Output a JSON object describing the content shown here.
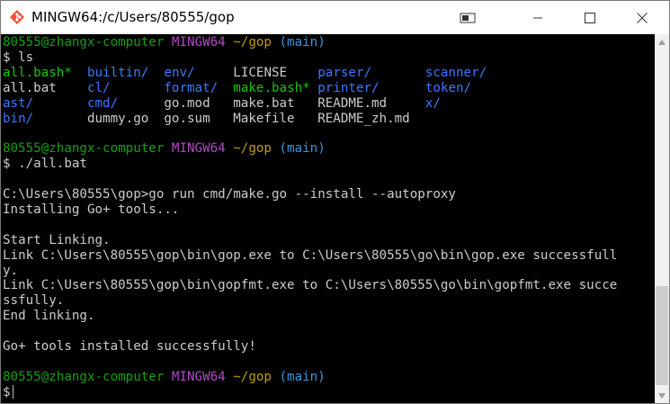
{
  "window": {
    "title": "MINGW64:/c/Users/80555/gop"
  },
  "colors": {
    "green": "#13a10e",
    "purple": "#b148c6",
    "yellow": "#c19c00",
    "cyan": "#3a96dd",
    "white": "#cccccc",
    "blue": "#3b78ff",
    "bright_green": "#16c60c",
    "bright_purple": "#b4009e"
  },
  "terminal": {
    "lines": [
      [
        {
          "t": "80555@zhangx-computer ",
          "c": "#13a10e"
        },
        {
          "t": "MINGW64 ",
          "c": "#b148c6"
        },
        {
          "t": "~/gop ",
          "c": "#c19c00"
        },
        {
          "t": "(main)",
          "c": "#3a96dd"
        }
      ],
      [
        {
          "t": "$ ls",
          "c": "#cccccc"
        }
      ],
      [
        {
          "t": "all.bash*",
          "c": "#16c60c"
        },
        {
          "t": "  ",
          "c": "#cccccc"
        },
        {
          "t": "builtin/",
          "c": "#3b78ff"
        },
        {
          "t": "  ",
          "c": "#cccccc"
        },
        {
          "t": "env/",
          "c": "#3b78ff"
        },
        {
          "t": "     LICENSE    ",
          "c": "#cccccc"
        },
        {
          "t": "parser/",
          "c": "#3b78ff"
        },
        {
          "t": "       ",
          "c": "#cccccc"
        },
        {
          "t": "scanner/",
          "c": "#3b78ff"
        }
      ],
      [
        {
          "t": "all.bat    ",
          "c": "#cccccc"
        },
        {
          "t": "cl/",
          "c": "#3b78ff"
        },
        {
          "t": "       ",
          "c": "#cccccc"
        },
        {
          "t": "format/",
          "c": "#3b78ff"
        },
        {
          "t": "  ",
          "c": "#cccccc"
        },
        {
          "t": "make.bash*",
          "c": "#16c60c"
        },
        {
          "t": " ",
          "c": "#cccccc"
        },
        {
          "t": "printer/",
          "c": "#3b78ff"
        },
        {
          "t": "      ",
          "c": "#cccccc"
        },
        {
          "t": "token/",
          "c": "#3b78ff"
        }
      ],
      [
        {
          "t": "ast/",
          "c": "#3b78ff"
        },
        {
          "t": "       ",
          "c": "#cccccc"
        },
        {
          "t": "cmd/",
          "c": "#3b78ff"
        },
        {
          "t": "      go.mod   make.bat   README.md     ",
          "c": "#cccccc"
        },
        {
          "t": "x/",
          "c": "#3b78ff"
        }
      ],
      [
        {
          "t": "bin/",
          "c": "#3b78ff"
        },
        {
          "t": "       dummy.go  go.sum   Makefile   README_zh.md",
          "c": "#cccccc"
        }
      ],
      [],
      [
        {
          "t": "80555@zhangx-computer ",
          "c": "#13a10e"
        },
        {
          "t": "MINGW64 ",
          "c": "#b148c6"
        },
        {
          "t": "~/gop ",
          "c": "#c19c00"
        },
        {
          "t": "(main)",
          "c": "#3a96dd"
        }
      ],
      [
        {
          "t": "$ ./all.bat",
          "c": "#cccccc"
        }
      ],
      [],
      [
        {
          "t": "C:\\Users\\80555\\gop>go run cmd/make.go --install --autoproxy",
          "c": "#cccccc"
        }
      ],
      [
        {
          "t": "Installing Go+ tools...",
          "c": "#cccccc"
        }
      ],
      [],
      [
        {
          "t": "Start Linking.",
          "c": "#cccccc"
        }
      ],
      [
        {
          "t": "Link C:\\Users\\80555\\gop\\bin\\gop.exe to C:\\Users\\80555\\go\\bin\\gop.exe successfull",
          "c": "#cccccc"
        }
      ],
      [
        {
          "t": "y.",
          "c": "#cccccc"
        }
      ],
      [
        {
          "t": "Link C:\\Users\\80555\\gop\\bin\\gopfmt.exe to C:\\Users\\80555\\go\\bin\\gopfmt.exe succe",
          "c": "#cccccc"
        }
      ],
      [
        {
          "t": "ssfully.",
          "c": "#cccccc"
        }
      ],
      [
        {
          "t": "End linking.",
          "c": "#cccccc"
        }
      ],
      [],
      [
        {
          "t": "Go+ tools installed successfully!",
          "c": "#cccccc"
        }
      ],
      [],
      [
        {
          "t": "80555@zhangx-computer ",
          "c": "#13a10e"
        },
        {
          "t": "MINGW64 ",
          "c": "#b148c6"
        },
        {
          "t": "~/gop ",
          "c": "#c19c00"
        },
        {
          "t": "(main)",
          "c": "#3a96dd"
        }
      ],
      [
        {
          "t": "$",
          "c": "#cccccc"
        }
      ]
    ]
  }
}
